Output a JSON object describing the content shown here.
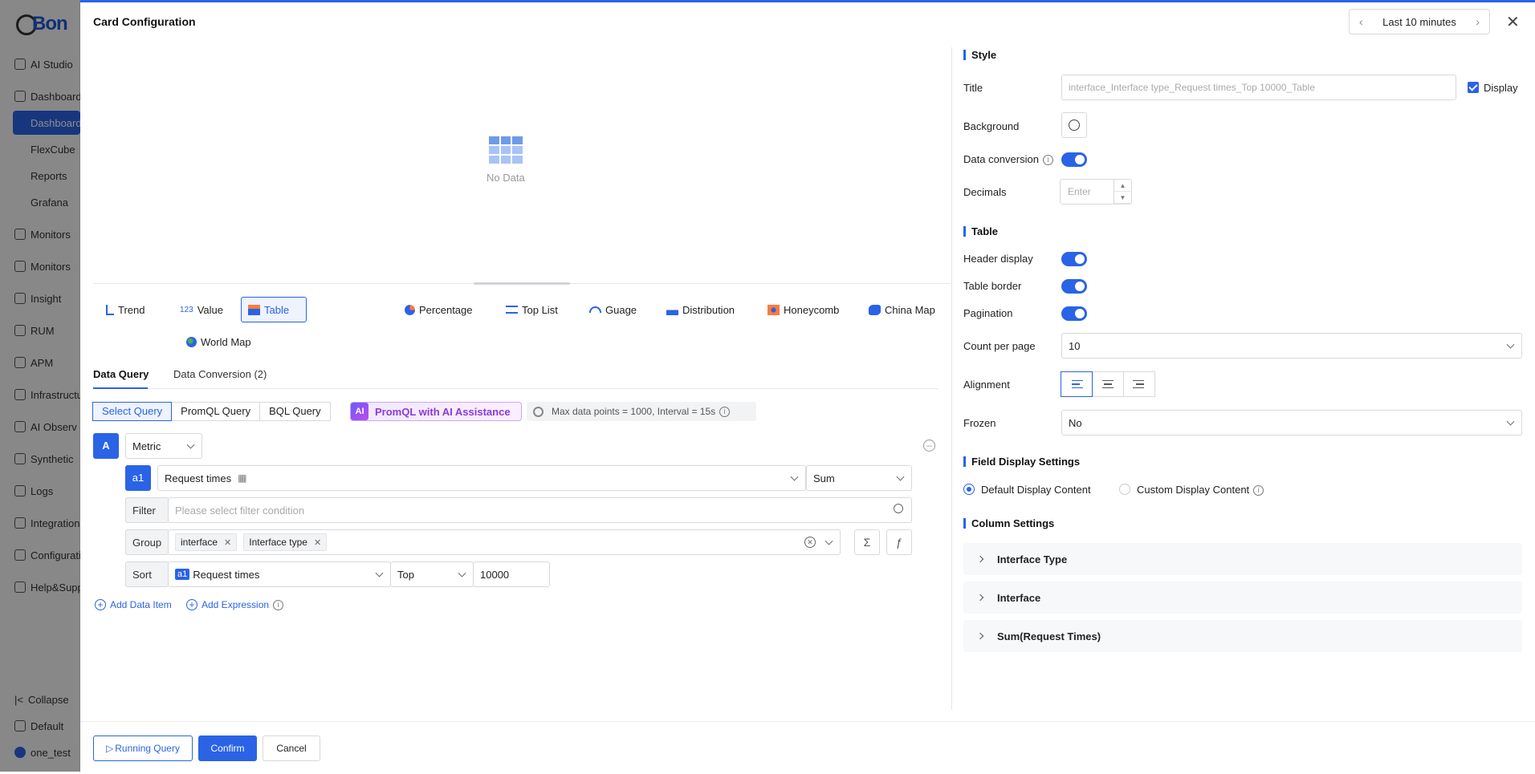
{
  "sidebar": {
    "logo_text": "Bon",
    "items": [
      {
        "label": "AI Studio",
        "icon": "ai-icon"
      },
      {
        "label": "Dashboards",
        "icon": "dashboard-icon"
      },
      {
        "label": "Monitors",
        "icon": "monitor-icon"
      },
      {
        "label": "Monitors",
        "icon": "monitor-icon"
      },
      {
        "label": "Insight",
        "icon": "insight-icon"
      },
      {
        "label": "RUM",
        "icon": "rum-icon"
      },
      {
        "label": "APM",
        "icon": "apm-icon"
      },
      {
        "label": "Infrastructur",
        "icon": "infra-icon"
      },
      {
        "label": "AI Observ",
        "icon": "ai-observ-icon"
      },
      {
        "label": "Synthetic",
        "icon": "synthetic-icon"
      },
      {
        "label": "Logs",
        "icon": "logs-icon"
      },
      {
        "label": "Integration",
        "icon": "integration-icon"
      },
      {
        "label": "Configuratio",
        "icon": "config-icon"
      },
      {
        "label": "Help&Supp",
        "icon": "help-icon"
      }
    ],
    "sub_items": [
      "Dashboards",
      "FlexCube",
      "Reports",
      "Grafana"
    ],
    "collapse": "Collapse",
    "workspace": "Default",
    "user": "one_test"
  },
  "modal": {
    "title": "Card Configuration",
    "time_range": "Last 10 minutes"
  },
  "preview": {
    "no_data": "No Data"
  },
  "chart_types": [
    {
      "label": "Trend"
    },
    {
      "label": "Value"
    },
    {
      "label": "Table"
    },
    {
      "label": "Percentage"
    },
    {
      "label": "Top List"
    },
    {
      "label": "Guage"
    },
    {
      "label": "Distribution"
    },
    {
      "label": "Honeycomb"
    },
    {
      "label": "China Map"
    },
    {
      "label": "World Map"
    }
  ],
  "tabs": {
    "data_query": "Data Query",
    "data_conversion": "Data Conversion (2)"
  },
  "query_modes": [
    "Select Query",
    "PromQL Query",
    "BQL Query"
  ],
  "ai_assist": {
    "badge": "AI",
    "label": "PromQL with AI Assistance"
  },
  "max_points": "Max data points = 1000, Interval = 15s",
  "query": {
    "letter": "A",
    "source": "Metric",
    "item_id": "a1",
    "metric": "Request times",
    "agg": "Sum",
    "filter_label": "Filter",
    "filter_placeholder": "Please select filter condition",
    "group_label": "Group",
    "group_tags": [
      "interface",
      "Interface type"
    ],
    "sort_label": "Sort",
    "sort_field": "Request times",
    "sort_order": "Top",
    "sort_limit": "10000"
  },
  "add_links": {
    "data_item": "Add Data Item",
    "expression": "Add Expression"
  },
  "footer": {
    "running": "Running Query",
    "confirm": "Confirm",
    "cancel": "Cancel"
  },
  "style": {
    "section": "Style",
    "title_label": "Title",
    "title_value": "interface_Interface type_Request times_Top 10000_Table",
    "display_label": "Display",
    "background_label": "Background",
    "data_conversion_label": "Data conversion",
    "decimals_label": "Decimals",
    "decimals_placeholder": "Enter"
  },
  "table": {
    "section": "Table",
    "header_display": "Header display",
    "table_border": "Table border",
    "pagination": "Pagination",
    "count_label": "Count per page",
    "count_value": "10",
    "alignment_label": "Alignment",
    "frozen_label": "Frozen",
    "frozen_value": "No"
  },
  "field_display": {
    "section": "Field Display Settings",
    "default": "Default Display Content",
    "custom": "Custom Display Content"
  },
  "column_settings": {
    "section": "Column Settings",
    "columns": [
      "Interface Type",
      "Interface",
      "Sum(Request Times)"
    ]
  },
  "colors": {
    "accent": "#2a63e6"
  }
}
